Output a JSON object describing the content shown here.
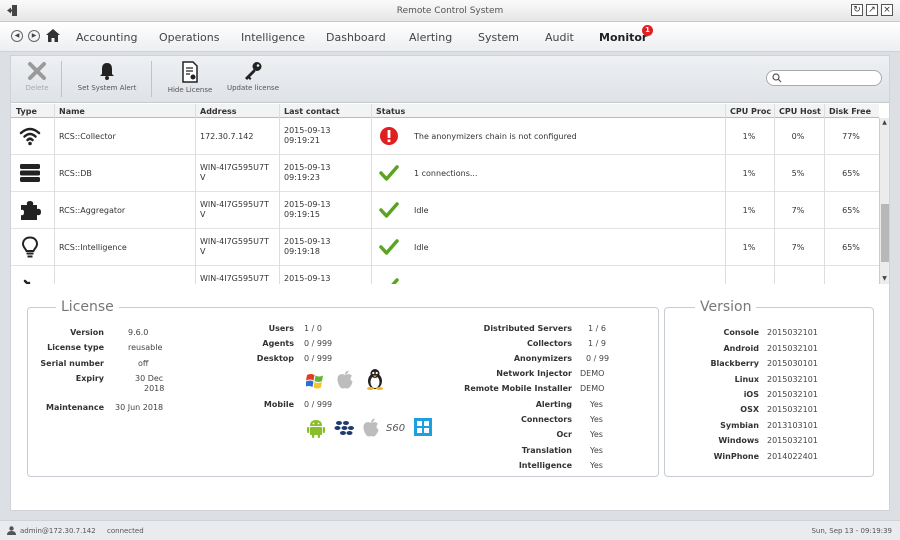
{
  "window": {
    "title": "Remote Control System"
  },
  "nav": {
    "tabs": [
      "Accounting",
      "Operations",
      "Intelligence",
      "Dashboard",
      "Alerting",
      "System",
      "Audit",
      "Monitor"
    ],
    "active": "Monitor",
    "badge": "1"
  },
  "toolbar": {
    "delete": "Delete",
    "alert": "Set System Alert",
    "hide": "Hide License",
    "update": "Update license",
    "search_placeholder": ""
  },
  "table": {
    "headers": [
      "Type",
      "Name",
      "Address",
      "Last contact",
      "Status",
      "CPU Proc",
      "CPU Host",
      "Disk Free"
    ],
    "rows": [
      {
        "icon": "wifi-icon",
        "name": "RCS::Collector",
        "address": "172.30.7.142",
        "contact1": "2015-09-13",
        "contact2": "09:19:21",
        "status_icon": "error-icon",
        "status": "The anonymizers chain is not configured",
        "cpu_proc": "1%",
        "cpu_host": "0%",
        "disk": "77%"
      },
      {
        "icon": "database-icon",
        "name": "RCS::DB",
        "address": "WIN-4I7G595U7T",
        "address2": "V",
        "contact1": "2015-09-13",
        "contact2": "09:19:23",
        "status_icon": "check-icon",
        "status": "1 connections...",
        "cpu_proc": "1%",
        "cpu_host": "5%",
        "disk": "65%"
      },
      {
        "icon": "puzzle-icon",
        "name": "RCS::Aggregator",
        "address": "WIN-4I7G595U7T",
        "address2": "V",
        "contact1": "2015-09-13",
        "contact2": "09:19:15",
        "status_icon": "check-icon",
        "status": "Idle",
        "cpu_proc": "1%",
        "cpu_host": "7%",
        "disk": "65%"
      },
      {
        "icon": "bulb-icon",
        "name": "RCS::Intelligence",
        "address": "WIN-4I7G595U7T",
        "address2": "V",
        "contact1": "2015-09-13",
        "contact2": "09:19:18",
        "status_icon": "check-icon",
        "status": "Idle",
        "cpu_proc": "1%",
        "cpu_host": "7%",
        "disk": "65%"
      },
      {
        "icon": "tool-icon",
        "name": "",
        "address": "WIN-4I7G595U7T",
        "address2": "",
        "contact1": "2015-09-13",
        "contact2": "",
        "status_icon": "check-icon",
        "status": "",
        "cpu_proc": "",
        "cpu_host": "",
        "disk": ""
      }
    ]
  },
  "license": {
    "title": "License",
    "left": [
      {
        "k": "Version",
        "v": "9.6.0"
      },
      {
        "k": "License type",
        "v": "reusable"
      },
      {
        "k": "Serial number",
        "v": "off"
      },
      {
        "k": "Expiry",
        "v": "30 Dec",
        "v2": "2018"
      },
      {
        "k": "Maintenance",
        "v": "30 Jun 2018"
      }
    ],
    "mid": [
      {
        "k": "Users",
        "v": "1 / 0"
      },
      {
        "k": "Agents",
        "v": "0 / 999"
      },
      {
        "k": "Desktop",
        "v": "0 / 999"
      },
      {
        "k": "Mobile",
        "v": "0 / 999"
      }
    ],
    "right": [
      {
        "k": "Distributed Servers",
        "v": "1 / 6"
      },
      {
        "k": "Collectors",
        "v": "1 / 9"
      },
      {
        "k": "Anonymizers",
        "v": "0 / 99"
      },
      {
        "k": "Network Injector",
        "v": "DEMO"
      },
      {
        "k": "Remote Mobile Installer",
        "v": "DEMO"
      },
      {
        "k": "Alerting",
        "v": "Yes"
      },
      {
        "k": "Connectors",
        "v": "Yes"
      },
      {
        "k": "Ocr",
        "v": "Yes"
      },
      {
        "k": "Translation",
        "v": "Yes"
      },
      {
        "k": "Intelligence",
        "v": "Yes"
      }
    ],
    "symbian_label": "S60"
  },
  "version": {
    "title": "Version",
    "items": [
      {
        "k": "Console",
        "v": "2015032101"
      },
      {
        "k": "Android",
        "v": "2015032101"
      },
      {
        "k": "Blackberry",
        "v": "2015030101"
      },
      {
        "k": "Linux",
        "v": "2015032101"
      },
      {
        "k": "iOS",
        "v": "2015032101"
      },
      {
        "k": "OSX",
        "v": "2015032101"
      },
      {
        "k": "Symbian",
        "v": "2013103101"
      },
      {
        "k": "Windows",
        "v": "2015032101"
      },
      {
        "k": "WinPhone",
        "v": "2014022401"
      }
    ]
  },
  "status": {
    "user": "admin@172.30.7.142",
    "state": "connected",
    "time": "Sun, Sep 13 - 09:19:39"
  },
  "colors": {
    "error": "#e02020",
    "ok": "#5ba322",
    "android": "#8bbf2a",
    "windows": "#1e9fe0"
  }
}
